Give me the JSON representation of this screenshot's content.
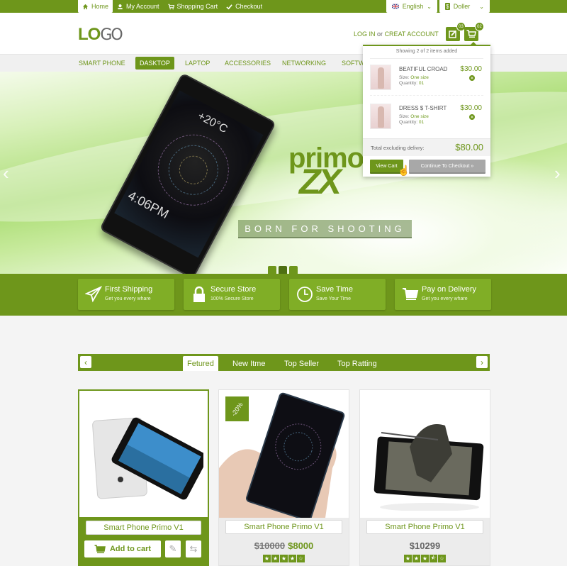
{
  "topbar": {
    "links": [
      {
        "label": "Home",
        "icon": "home-icon",
        "active": true
      },
      {
        "label": "My Account",
        "icon": "user-icon"
      },
      {
        "label": "Shopping Cart",
        "icon": "cart-icon"
      },
      {
        "label": "Checkout",
        "icon": "check-icon"
      }
    ],
    "language": "English",
    "currency": "Doller"
  },
  "header": {
    "logo_bold": "LO",
    "logo_light": "GO",
    "login": "LOG IN",
    "or": "or",
    "create_account": "CREAT ACCOUNT",
    "wishlist_count": "03",
    "cart_count": "02"
  },
  "nav": {
    "items": [
      "SMART PHONE",
      "DASKTOP",
      "LAPTOP",
      "ACCESSORIES",
      "NETWORKING",
      "SOFTWA"
    ],
    "active_index": 1
  },
  "hero": {
    "brand_line1": "primo",
    "brand_line2": "ZX",
    "tagline": "BORN FOR SHOOTING",
    "phone_temp": "+20°C",
    "phone_time": "4:06PM",
    "slides": 3,
    "active_slide": 1,
    "prev": "‹",
    "next": "›"
  },
  "features": [
    {
      "title": "First Shipping",
      "subtitle": "Get you every whare",
      "icon": "paper-plane-icon"
    },
    {
      "title": "Secure Store",
      "subtitle": "100% Secure Store",
      "icon": "lock-icon"
    },
    {
      "title": "Save Time",
      "subtitle": "Save Your Time",
      "icon": "clock-icon"
    },
    {
      "title": "Pay on Delivery",
      "subtitle": "Get you every whare",
      "icon": "cart-icon"
    }
  ],
  "tabs": {
    "items": [
      "Fetured",
      "New Itme",
      "Top Seller",
      "Top Ratting"
    ],
    "active_index": 0,
    "prev": "‹",
    "next": "›"
  },
  "products": [
    {
      "name": "Smart Phone  Primo V1",
      "add_to_cart": "Add to cart",
      "selected": true
    },
    {
      "name": "Smart Phone  Primo V1",
      "old_price": "$10000",
      "price": "$8000",
      "discount": "-20%",
      "rating": 4,
      "max_rating": 5
    },
    {
      "name": "Smart Phone  Primo V1",
      "price": "$10299",
      "rating": 3.5,
      "max_rating": 5
    }
  ],
  "cart_dropdown": {
    "header": "Showing 2 of 2 items added",
    "items": [
      {
        "title": "BEATIFUL CROAD",
        "size_label": "Size:",
        "size": "One size",
        "qty_label": "Quantity:",
        "qty": "01",
        "price": "$30.00"
      },
      {
        "title": "DRESS $ T-SHIRT",
        "size_label": "Size:",
        "size": "One size",
        "qty_label": "Quantity:",
        "qty": "01",
        "price": "$30.00"
      }
    ],
    "total_label": "Total excluding delivry:",
    "total": "$80.00",
    "view_cart": "View Cart",
    "checkout": "Continue To Checkout »"
  },
  "colors": {
    "brand": "#6e961b",
    "brand_light": "#80ae26",
    "grey_button": "#a8a8a8"
  }
}
